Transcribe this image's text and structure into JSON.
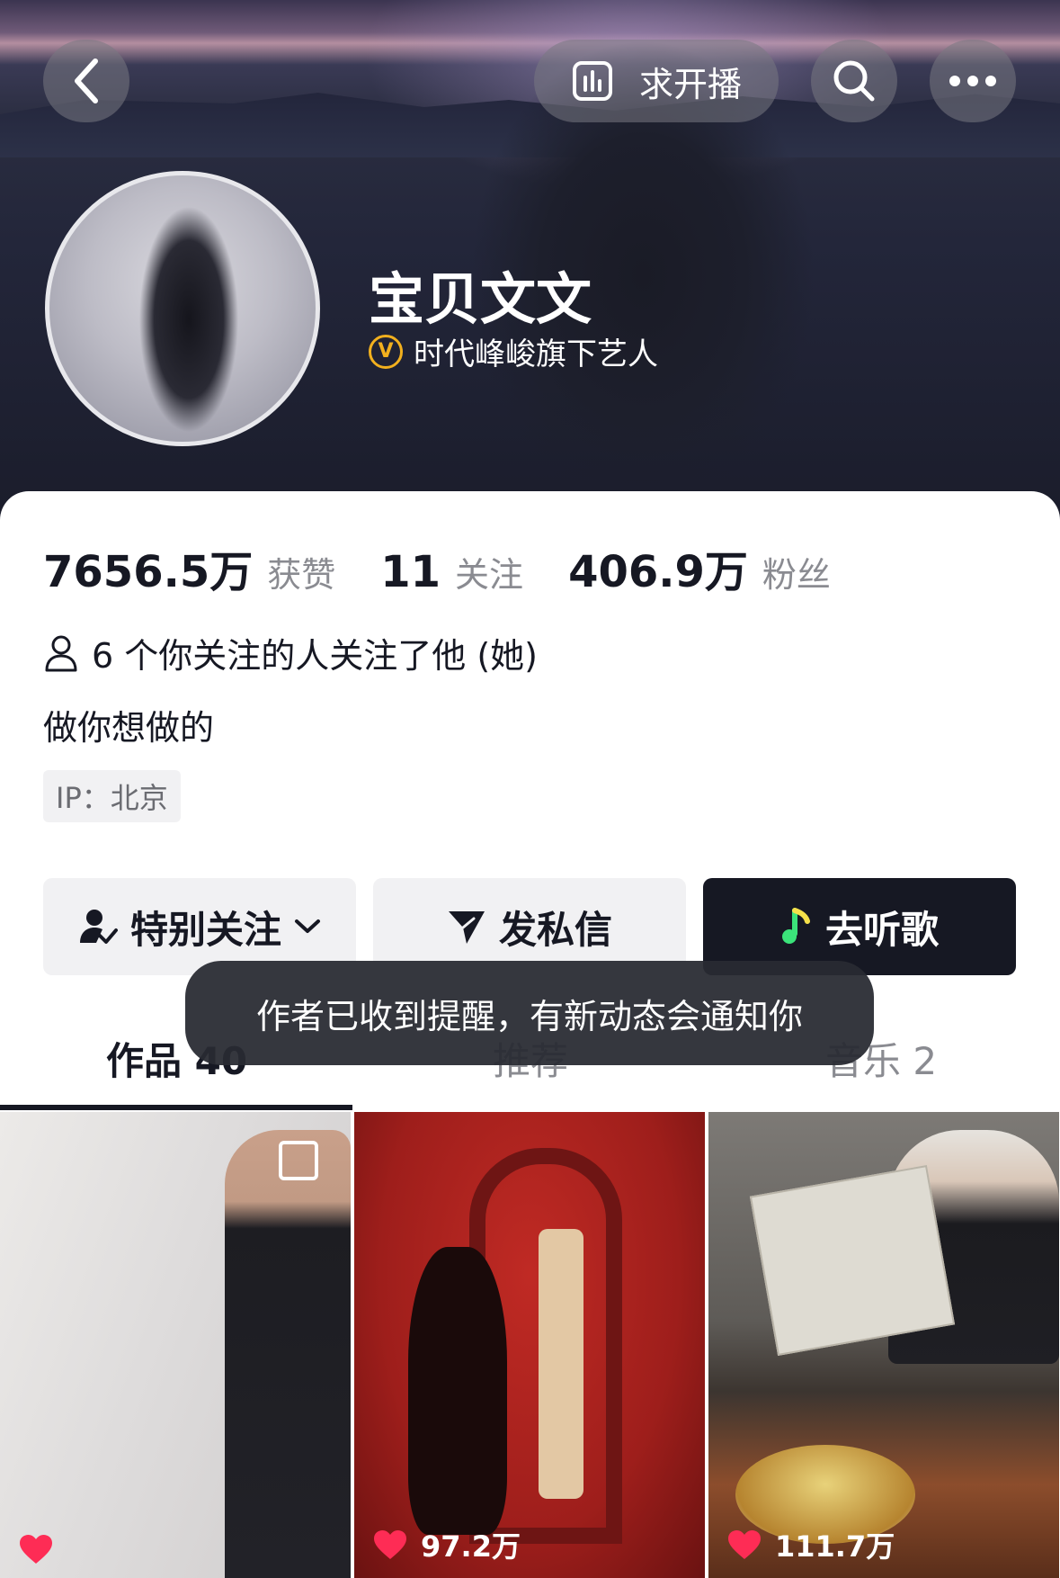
{
  "header": {
    "live_label": "求开播"
  },
  "profile": {
    "name": "宝贝文文",
    "verified_label": "时代峰峻旗下艺人"
  },
  "stats": [
    {
      "value": "7656.5万",
      "label": "获赞"
    },
    {
      "value": "11",
      "label": "关注"
    },
    {
      "value": "406.9万",
      "label": "粉丝"
    }
  ],
  "mutual_text": "6 个你关注的人关注了他 (她)",
  "bio": "做你想做的",
  "ip_tag": "IP：北京",
  "actions": {
    "follow_label": "特别关注",
    "message_label": "发私信",
    "music_label": "去听歌"
  },
  "tabs": [
    {
      "label": "作品 40"
    },
    {
      "label": "推荐"
    },
    {
      "label": "音乐 2"
    }
  ],
  "toast": "作者已收到提醒，有新动态会通知你",
  "grid": [
    {
      "likes": ""
    },
    {
      "likes": "97.2万"
    },
    {
      "likes": "111.7万"
    }
  ],
  "icons": {
    "back": "chevron-left-icon",
    "live": "bar-chart-icon",
    "search": "search-icon",
    "more": "more-dots-icon",
    "verified": "verified-v-icon",
    "people": "person-icon",
    "follow": "person-check-icon",
    "message": "send-icon",
    "music": "music-note-icon",
    "like": "heart-icon",
    "multi": "multi-image-icon"
  },
  "colors": {
    "accent_heart": "#fe2c55",
    "verified_gold": "#f2b01e",
    "dark_button": "#161823"
  }
}
